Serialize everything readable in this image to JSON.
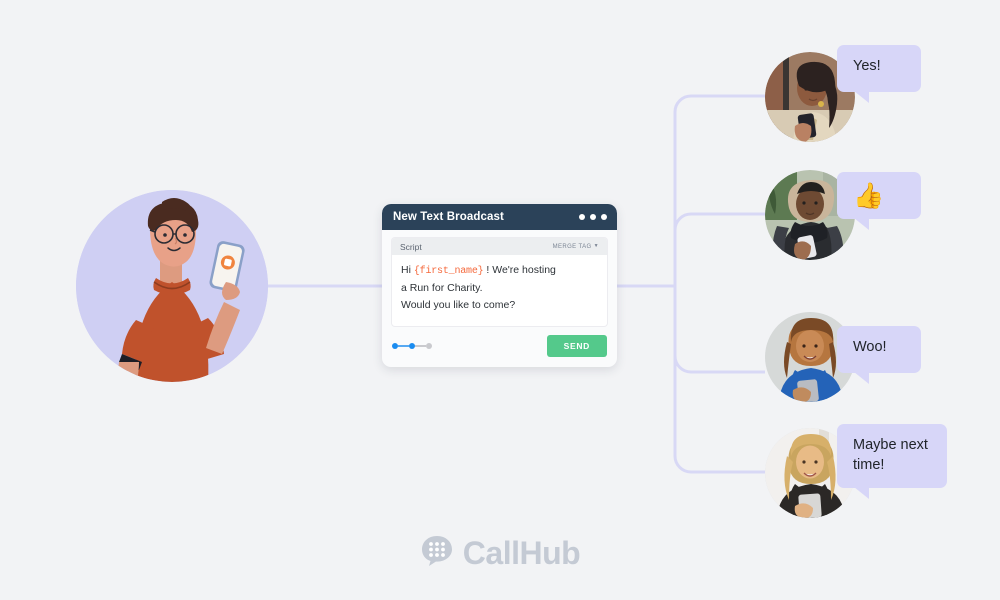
{
  "page": {
    "background_color": "#f2f3f5",
    "connector_color": "#d8d8f5"
  },
  "persona": {
    "name": "sender-illustration",
    "circle_color": "#cfcff3",
    "shirt_color": "#c0522c",
    "hair_color": "#4a2b20",
    "skin_color": "#e8a188"
  },
  "broadcast_card": {
    "title": "New Text Broadcast",
    "window_dots": 3,
    "header_color": "#2b4259",
    "script": {
      "label": "Script",
      "merge_tag_label": "MERGE TAG",
      "merge_tag_caret": "▼",
      "line1_prefix": "Hi ",
      "merge_token": "{first_name}",
      "line1_suffix": " ! We're hosting",
      "line2": "a Run for Charity.",
      "line3": "Would you like to come?",
      "merge_token_color": "#f5693c"
    },
    "steps": {
      "total": 3,
      "current": 2,
      "active_color": "#1a8cf0",
      "inactive_color": "#c9cace"
    },
    "send_label": "SEND",
    "send_color": "#54c98b"
  },
  "responders": [
    {
      "avatar_name": "avatar-woman-curly-hair",
      "reply": "Yes!",
      "reply_type": "text",
      "bubble_color": "#d7d6f8"
    },
    {
      "avatar_name": "avatar-man-fur-hood",
      "reply": "👍",
      "reply_type": "emoji",
      "bubble_color": "#d7d6f8"
    },
    {
      "avatar_name": "avatar-woman-blue-top",
      "reply": "Woo!",
      "reply_type": "text",
      "bubble_color": "#d7d6f8"
    },
    {
      "avatar_name": "avatar-woman-blonde",
      "reply": "Maybe next time!",
      "reply_type": "text",
      "bubble_color": "#d7d6f8"
    }
  ],
  "brand": {
    "name": "CallHub",
    "logo_name": "callhub-dialpad-bubble-logo",
    "color": "#c4cad4"
  }
}
